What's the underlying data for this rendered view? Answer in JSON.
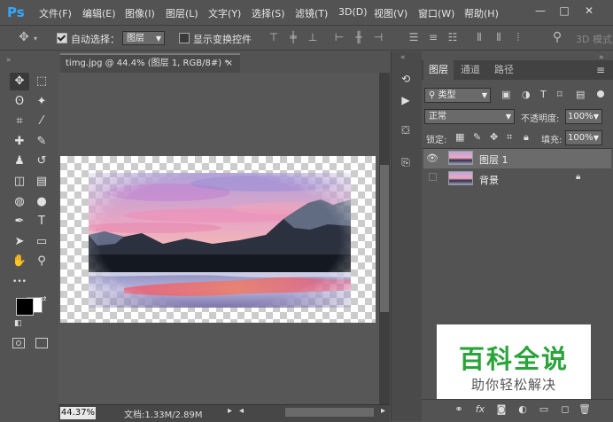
{
  "app": {
    "logo": "Ps",
    "menus": [
      "文件(F)",
      "编辑(E)",
      "图像(I)",
      "图层(L)",
      "文字(Y)",
      "选择(S)",
      "滤镜(T)",
      "3D(D)",
      "视图(V)",
      "窗口(W)",
      "帮助(H)"
    ],
    "window_controls": {
      "minimize": "—",
      "maximize": "□",
      "close": "✕"
    }
  },
  "options_bar": {
    "auto_select_label": "自动选择：",
    "auto_select_checked": true,
    "auto_select_target": "图层",
    "show_transform_label": "显示变换控件",
    "show_transform_checked": false,
    "mode_3d_label": "3D 模式"
  },
  "document": {
    "tab_title": "timg.jpg @ 44.4% (图层 1, RGB/8#) *",
    "tab_close": "×",
    "zoom": "44.37%",
    "doc_info": "文档:1.33M/2.89M"
  },
  "tools": [
    [
      "move-tool",
      "✥"
    ],
    [
      "marquee-tool",
      "⬚"
    ],
    [
      "lasso-tool",
      "ʘ"
    ],
    [
      "magic-wand-tool",
      "✦"
    ],
    [
      "crop-tool",
      "⌗"
    ],
    [
      "eyedropper-tool",
      "⁄"
    ],
    [
      "healing-brush-tool",
      "✚"
    ],
    [
      "brush-tool",
      "✎"
    ],
    [
      "clone-stamp-tool",
      "♟"
    ],
    [
      "history-brush-tool",
      "↺"
    ],
    [
      "eraser-tool",
      "◫"
    ],
    [
      "gradient-tool",
      "▤"
    ],
    [
      "blur-tool",
      "◍"
    ],
    [
      "dodge-tool",
      "●"
    ],
    [
      "pen-tool",
      "✒"
    ],
    [
      "type-tool",
      "T"
    ],
    [
      "path-selection-tool",
      "➤"
    ],
    [
      "shape-tool",
      "▭"
    ],
    [
      "hand-tool",
      "✋"
    ],
    [
      "zoom-tool",
      "⚲"
    ],
    [
      "more-tools",
      "•••"
    ]
  ],
  "colors": {
    "foreground": "#000000",
    "background": "#ffffff",
    "accent": "#31a8ff"
  },
  "layers_panel": {
    "tabs": [
      "图层",
      "通道",
      "路径"
    ],
    "active_tab": 0,
    "filter_label": "类型",
    "blend_mode": "正常",
    "opacity_label": "不透明度:",
    "opacity_value": "100%",
    "lock_label": "锁定:",
    "fill_label": "填充:",
    "fill_value": "100%",
    "layers": [
      {
        "name": "图层 1",
        "visible": true,
        "selected": true,
        "locked": false
      },
      {
        "name": "背景",
        "visible": false,
        "selected": false,
        "locked": true
      }
    ]
  },
  "watermark": {
    "title": "百科全说",
    "subtitle": "助你轻松解决"
  }
}
